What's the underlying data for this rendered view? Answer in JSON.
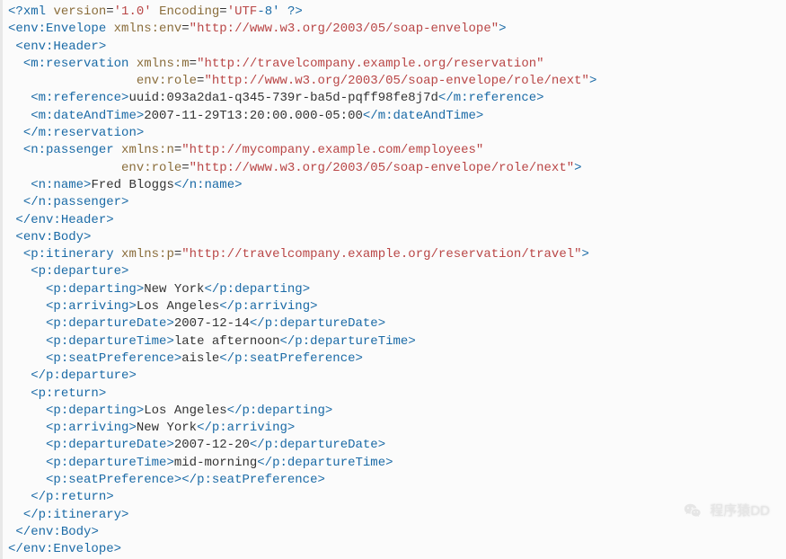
{
  "xml_decl": {
    "version": "'1.0'",
    "encoding_label": "'UTF",
    "encoding_tail": "-8'"
  },
  "envelope": {
    "tag": "env:Envelope",
    "ns_attr": "xmlns:env",
    "ns_val": "\"http://www.w3.org/2003/05/soap-envelope\""
  },
  "header_tag": "env:Header",
  "reservation": {
    "tag": "m:reservation",
    "ns_attr": "xmlns:m",
    "ns_val": "\"http://travelcompany.example.org/reservation\"",
    "role_attr": "env:role",
    "role_val": "\"http://www.w3.org/2003/05/soap-envelope/role/next\"",
    "reference_tag": "m:reference",
    "reference_text": "uuid:093a2da1-q345-739r-ba5d-pqff98fe8j7d",
    "date_tag": "m:dateAndTime",
    "date_text": "2007-11-29T13:20:00.000-05:00"
  },
  "passenger": {
    "tag": "n:passenger",
    "ns_attr": "xmlns:n",
    "ns_val": "\"http://mycompany.example.com/employees\"",
    "role_attr": "env:role",
    "role_val": "\"http://www.w3.org/2003/05/soap-envelope/role/next\"",
    "name_tag": "n:name",
    "name_text": "Fred Bloggs"
  },
  "body_tag": "env:Body",
  "itinerary": {
    "tag": "p:itinerary",
    "ns_attr": "xmlns:p",
    "ns_val": "\"http://travelcompany.example.org/reservation/travel\"",
    "departure": {
      "tag": "p:departure",
      "departing_tag": "p:departing",
      "departing": "New York",
      "arriving_tag": "p:arriving",
      "arriving": "Los Angeles",
      "date_tag": "p:departureDate",
      "date": "2007-12-14",
      "time_tag": "p:departureTime",
      "time": "late afternoon",
      "seat_tag": "p:seatPreference",
      "seat": "aisle"
    },
    "ret": {
      "tag": "p:return",
      "departing_tag": "p:departing",
      "departing": "Los Angeles",
      "arriving_tag": "p:arriving",
      "arriving": "New York",
      "date_tag": "p:departureDate",
      "date": "2007-12-20",
      "time_tag": "p:departureTime",
      "time": "mid-morning",
      "seat_tag": "p:seatPreference",
      "seat": ""
    }
  },
  "watermark": "程序猿DD"
}
